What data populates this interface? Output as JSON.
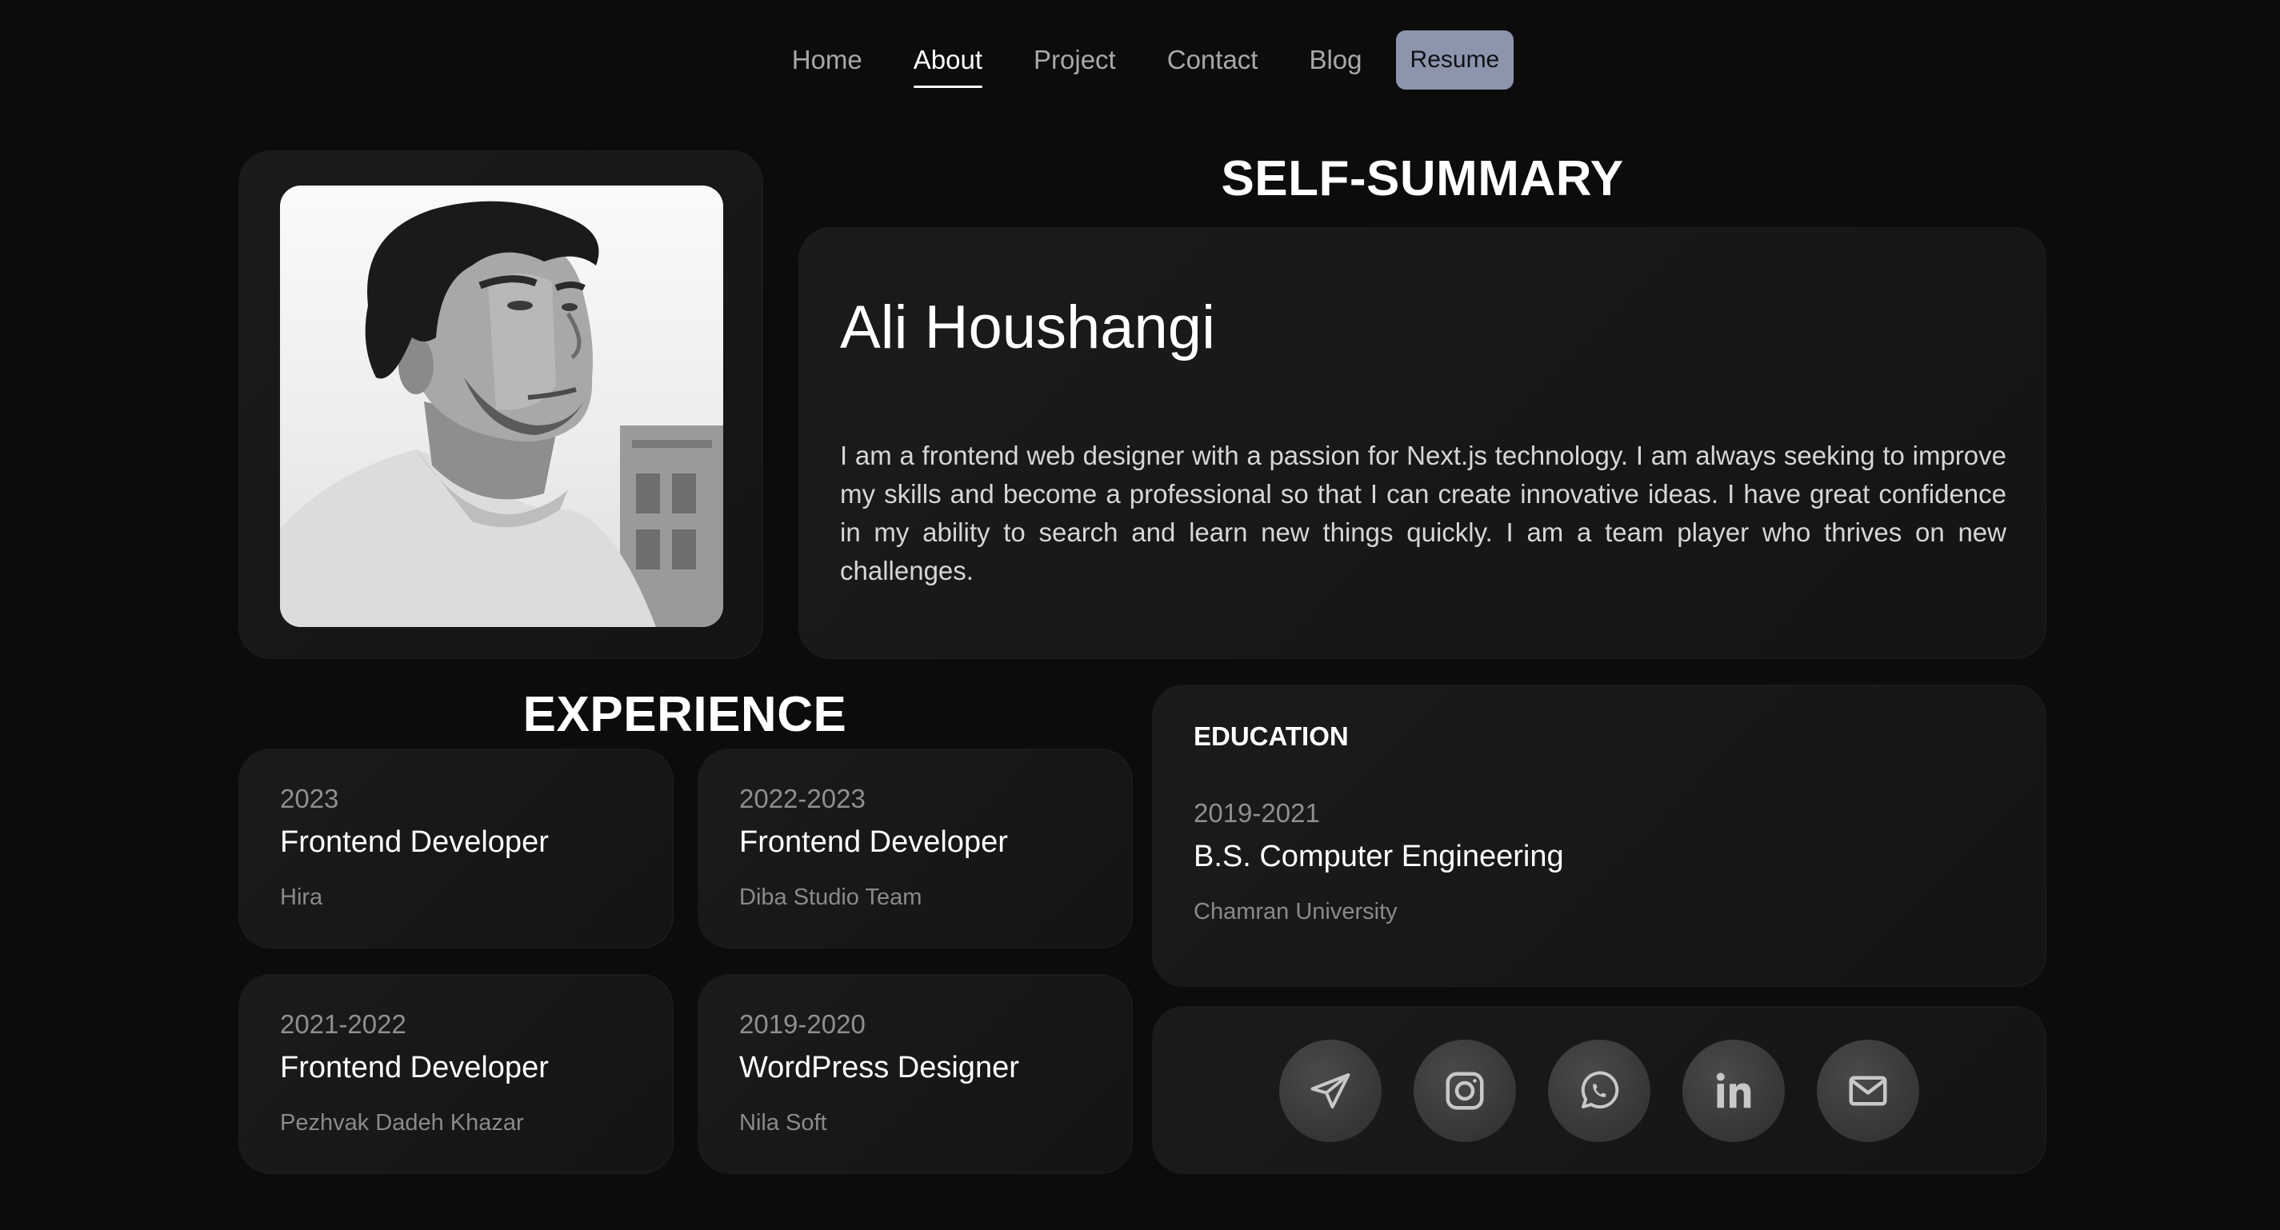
{
  "nav": {
    "items": [
      {
        "label": "Home",
        "active": false
      },
      {
        "label": "About",
        "active": true
      },
      {
        "label": "Project",
        "active": false
      },
      {
        "label": "Contact",
        "active": false
      },
      {
        "label": "Blog",
        "active": false
      }
    ],
    "resume_label": "Resume"
  },
  "profile": {
    "photo_icon": "portrait-photo"
  },
  "summary": {
    "title": "SELF-SUMMARY",
    "name": "Ali Houshangi",
    "text": "I am a frontend web designer with a passion for Next.js technology. I am always seeking to improve my skills and become a professional so that I can create innovative ideas. I have great confidence in my ability to search and learn new things quickly. I am a team player who thrives on new challenges."
  },
  "experience": {
    "title": "EXPERIENCE",
    "items": [
      {
        "years": "2023",
        "role": "Frontend Developer",
        "company": "Hira"
      },
      {
        "years": "2022-2023",
        "role": "Frontend Developer",
        "company": "Diba Studio Team"
      },
      {
        "years": "2021-2022",
        "role": "Frontend Developer",
        "company": "Pezhvak Dadeh Khazar"
      },
      {
        "years": "2019-2020",
        "role": "WordPress Designer",
        "company": "Nila Soft"
      }
    ]
  },
  "education": {
    "heading": "EDUCATION",
    "years": "2019-2021",
    "degree": "B.S. Computer Engineering",
    "school": "Chamran University"
  },
  "social": {
    "icons": [
      "telegram-icon",
      "instagram-icon",
      "whatsapp-icon",
      "linkedin-icon",
      "email-icon"
    ]
  },
  "colors": {
    "background": "#0c0c0d",
    "card": "#181819",
    "resume_button": "#8d95ad",
    "muted_text": "#8f8f8f"
  }
}
